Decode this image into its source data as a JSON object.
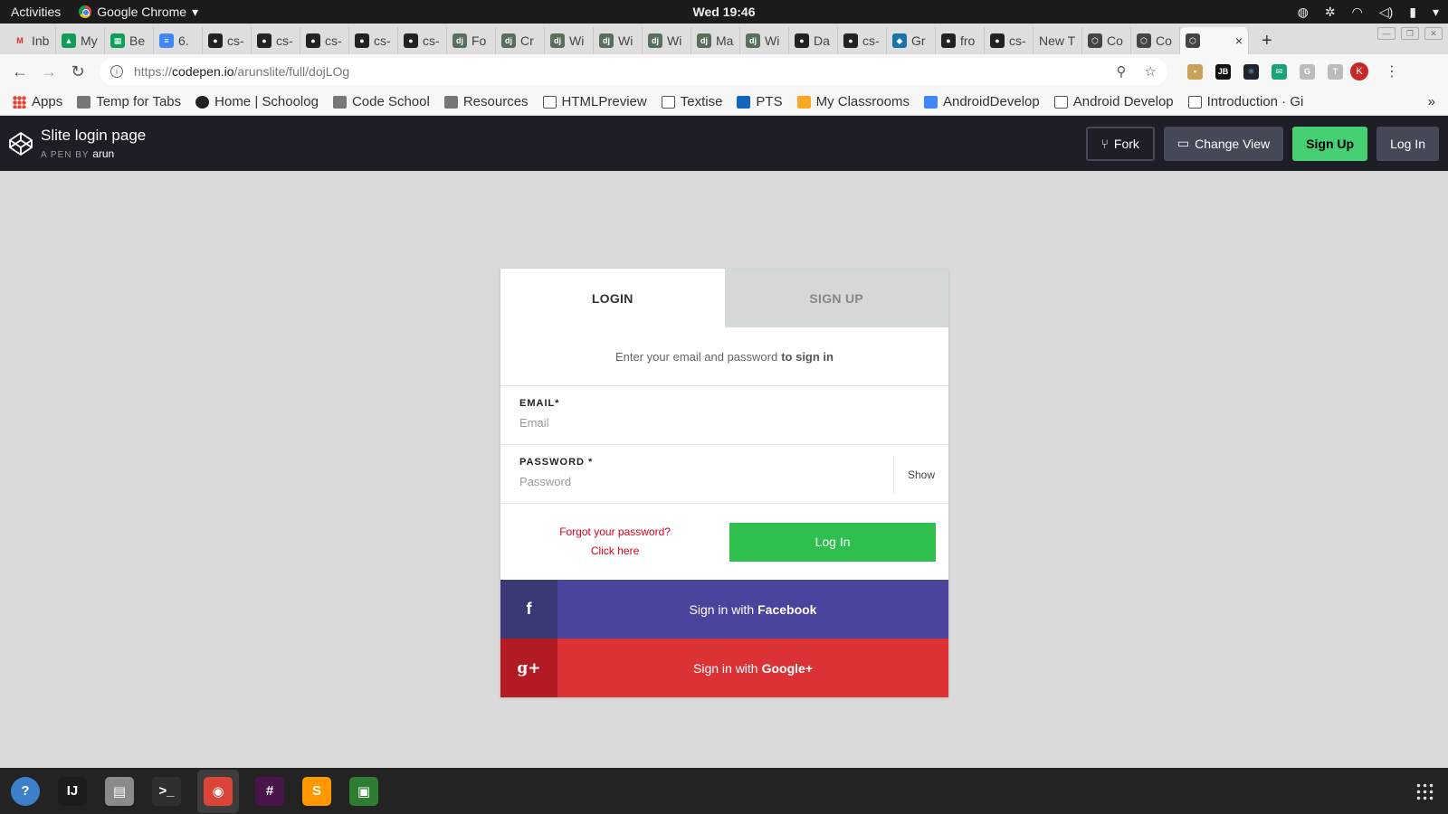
{
  "system": {
    "activities": "Activities",
    "app_name": "Google Chrome",
    "clock": "Wed 19:46"
  },
  "tabs": [
    {
      "label": "Inb",
      "icon": "gmail-icon",
      "fav": "M",
      "color": "#ffffff"
    },
    {
      "label": "My",
      "icon": "drive-icon",
      "fav": "▲",
      "color": "#0f9d58"
    },
    {
      "label": "Be",
      "icon": "sheets-icon",
      "fav": "▦",
      "color": "#0f9d58"
    },
    {
      "label": "6.",
      "icon": "docs-icon",
      "fav": "≡",
      "color": "#4285f4"
    },
    {
      "label": "cs-",
      "icon": "github-icon",
      "fav": "●",
      "color": "#222222"
    },
    {
      "label": "cs-",
      "icon": "github-icon",
      "fav": "●",
      "color": "#222222"
    },
    {
      "label": "cs-",
      "icon": "github-icon",
      "fav": "●",
      "color": "#222222"
    },
    {
      "label": "cs-",
      "icon": "github-icon",
      "fav": "●",
      "color": "#222222"
    },
    {
      "label": "cs-",
      "icon": "github-icon",
      "fav": "●",
      "color": "#222222"
    },
    {
      "label": "Fo",
      "icon": "django-icon",
      "fav": "dj",
      "color": "#5a6e5e"
    },
    {
      "label": "Cr",
      "icon": "django-icon",
      "fav": "dj",
      "color": "#5a6e5e"
    },
    {
      "label": "Wi",
      "icon": "django-icon",
      "fav": "dj",
      "color": "#5a6e5e"
    },
    {
      "label": "Wi",
      "icon": "django-icon",
      "fav": "dj",
      "color": "#5a6e5e"
    },
    {
      "label": "Wi",
      "icon": "django-icon",
      "fav": "dj",
      "color": "#5a6e5e"
    },
    {
      "label": "Ma",
      "icon": "django-icon",
      "fav": "dj",
      "color": "#5a6e5e"
    },
    {
      "label": "Wi",
      "icon": "django-icon",
      "fav": "dj",
      "color": "#5a6e5e"
    },
    {
      "label": "Da",
      "icon": "github-icon",
      "fav": "●",
      "color": "#222222"
    },
    {
      "label": "cs-",
      "icon": "github-icon",
      "fav": "●",
      "color": "#222222"
    },
    {
      "label": "Gr",
      "icon": "gradescope-icon",
      "fav": "◆",
      "color": "#1a73a8"
    },
    {
      "label": "fro",
      "icon": "github-icon",
      "fav": "●",
      "color": "#222222"
    },
    {
      "label": "cs-",
      "icon": "github-icon",
      "fav": "●",
      "color": "#222222"
    },
    {
      "label": "New T",
      "icon": "",
      "fav": "",
      "color": ""
    },
    {
      "label": "Co",
      "icon": "codepen-icon",
      "fav": "⬡",
      "color": "#444444"
    },
    {
      "label": "Co",
      "icon": "codepen-icon",
      "fav": "⬡",
      "color": "#444444"
    }
  ],
  "active_tab": {
    "icon": "codepen-icon",
    "close": "×"
  },
  "address": {
    "scheme": "https://",
    "host": "codepen.io",
    "path": "/arunslite/full/dojLOg"
  },
  "bookmarks": [
    {
      "label": "Apps",
      "type": "apps"
    },
    {
      "label": "Temp for Tabs",
      "type": "folder"
    },
    {
      "label": "Home | Schoolog",
      "type": "schoology"
    },
    {
      "label": "Code School",
      "type": "folder"
    },
    {
      "label": "Resources",
      "type": "folder"
    },
    {
      "label": "HTMLPreview",
      "type": "page"
    },
    {
      "label": "Textise",
      "type": "page"
    },
    {
      "label": "PTS",
      "type": "mb"
    },
    {
      "label": "My Classrooms",
      "type": "box"
    },
    {
      "label": "AndroidDevelop",
      "type": "drive"
    },
    {
      "label": "Android Develop",
      "type": "code"
    },
    {
      "label": "Introduction · Gi",
      "type": "book"
    }
  ],
  "codepen": {
    "title": "Slite login page",
    "by_prefix": "A PEN BY",
    "author": "arun",
    "fork": "Fork",
    "change_view": "Change View",
    "sign_up": "Sign Up",
    "log_in": "Log In"
  },
  "form": {
    "tab_login": "LOGIN",
    "tab_signup": "SIGN UP",
    "intro_text": "Enter your email and password",
    "intro_bold": "to sign in",
    "email_label": "EMAIL*",
    "email_placeholder": "Email",
    "password_label": "PASSWORD *",
    "password_placeholder": "Password",
    "show": "Show",
    "forgot_line1": "Forgot your password?",
    "forgot_line2": "Click here",
    "login_button": "Log In",
    "facebook_prefix": "Sign in with",
    "facebook_bold": "Facebook",
    "facebook_icon": "f",
    "google_prefix": "Sign in with",
    "google_bold": "Google+",
    "google_icon": "g+"
  },
  "dock": [
    {
      "name": "help-icon",
      "glyph": "?",
      "color": "#3d7ec9"
    },
    {
      "name": "intellij-icon",
      "glyph": "IJ",
      "color": "#1d1d1d"
    },
    {
      "name": "files-icon",
      "glyph": "▤",
      "color": "#8a8a8a"
    },
    {
      "name": "terminal-icon",
      "glyph": ">_",
      "color": "#2f2f2f"
    },
    {
      "name": "chrome-icon",
      "glyph": "◉",
      "color": "#db4437"
    },
    {
      "name": "slack-icon",
      "glyph": "#",
      "color": "#4a154b"
    },
    {
      "name": "sublime-icon",
      "glyph": "S",
      "color": "#ff9800"
    },
    {
      "name": "monitor-icon",
      "glyph": "▣",
      "color": "#2e7d32"
    }
  ]
}
